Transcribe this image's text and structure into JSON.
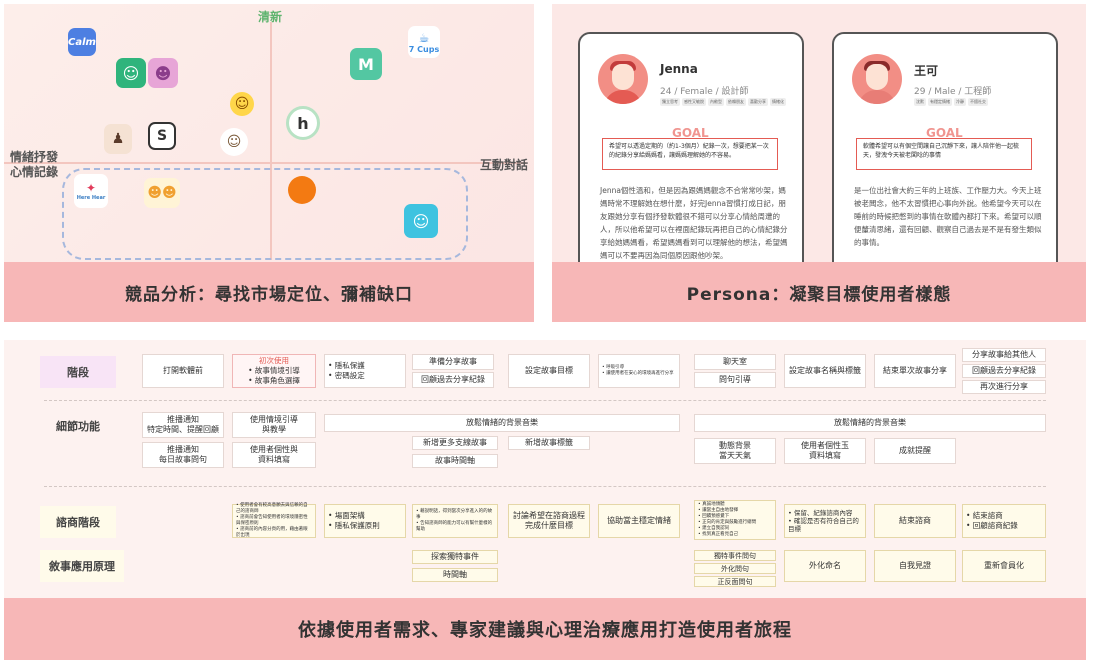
{
  "competitor": {
    "axis_top": "清新",
    "axis_left": "情緒抒發\n心情記錄",
    "axis_right": "互動對話",
    "banner": "競品分析：尋找市場定位、彌補缺口",
    "apps": [
      {
        "name": "calm",
        "label": "Calm"
      },
      {
        "name": "7cups",
        "label": "7 Cups"
      },
      {
        "name": "m-app",
        "label": "M"
      },
      {
        "name": "h-app",
        "label": "h"
      },
      {
        "name": "s-app",
        "label": "S"
      },
      {
        "name": "here-hear",
        "label": "Here Hear"
      }
    ]
  },
  "persona": {
    "banner": "Persona：凝聚目標使用者樣態",
    "goal_label": "GOAL",
    "cards": [
      {
        "name": "Jenna",
        "meta": "24 / Female / 設計師",
        "tags": [
          "獨立思考",
          "感性又敏銳",
          "內斂型",
          "依賴朋友",
          "喜歡分享",
          "情緒化"
        ],
        "goal": "希望可以透過定期的（約1-3個月）紀錄一次，想要把某一次的紀錄分享給媽媽看，讓媽媽理解她的不容易。",
        "desc": "Jenna個性溫和，但是因為跟媽媽觀念不合常常吵架，媽媽時常不理解她在想什麼，好完Jenna習慣打成日記，朋友跟她分享有個抒發軟體很不錯可以分享心情給周遭的人，所以他希望可以在裡面紀錄玩再把自己的心情紀錄分享給她媽媽看，希望媽媽看到可以理解他的想法，希望媽媽可以不要再因為同個原因跟他吵架。"
      },
      {
        "name": "王可",
        "meta": "29 / Male / 工程師",
        "tags": [
          "沈默",
          "有穩定情緒",
          "冷靜",
          "不擅社交"
        ],
        "goal": "軟體希望可以有個空間讓自己沉靜下來，讓人陪伴他一起梳天，發洩今天被老闆唸的事情",
        "desc": "是一位出社會大約三年的上班族、工作壓力大。今天上班被老闆念，他不太習慣把心事向外說。他希望今天可以在睡前的時候把憋到的事情在軟體內都打下來。希望可以順便釐清思緒，還有回顧、觀察自己過去是不是有發生類似的事情。"
      }
    ]
  },
  "journey": {
    "banner": "依據使用者需求、專家建議與心理治療應用打造使用者旅程",
    "row_labels": {
      "stage": "階段",
      "detail": "細節功能",
      "consult": "諮商階段",
      "narrative": "敘事應用原理"
    },
    "stages": {
      "open_app": "打開軟體前",
      "first_use_title": "初次使用",
      "first_use_items": "• 故事情境引導\n• 故事角色選擇",
      "privacy": "• 隱私保護\n• 密碼設定",
      "prepare_share": "準備分享故事",
      "review_share": "回顧過去分享紀錄",
      "set_goal": "設定故事目標",
      "guide": "• 呼吸引導\n• 讓使用者在安心的環境再進行分享",
      "chatroom": "聊天室",
      "questions": "問句引導",
      "name_story": "設定故事名稱與標籤",
      "end_share": "結束單次故事分享",
      "share_others": "分享故事給其他人",
      "review_record": "回顧過去分享紀錄",
      "share_again": "再次進行分享"
    },
    "details": {
      "notify1": "推播通知\n特定時間、提醒回顧",
      "notify2": "推播通知\n每日故事問句",
      "guide_teach": "使用情境引導\n與教學",
      "personal_info": "使用者個性與\n資料填寫",
      "bg_music1": "放鬆情緒的背景音樂",
      "more_stories": "新增更多支線故事",
      "story_tag": "新增故事標籤",
      "timeline": "故事時間軸",
      "bg_music2": "放鬆情緒的背景音樂",
      "dynamic_bg": "動態背景\n當天天氣",
      "personal_jade": "使用者個性玉\n資料填寫",
      "achievement": "成就提醒"
    },
    "consult": {
      "c1": "• 使用者會有較高意願去與信賴的自己的諮商師\n• 諮商前會告知使用者的環境隱密性與保密原則\n• 諮商前的內容分頁的用，藉由著眼於出現",
      "c2": "• 場面架構\n• 隱私保護原則",
      "c3": "• 藉說明話，得到當次分享進入的的故事\n• 告知諮商師的能力可以有幫什麼樣的幫助",
      "c4": "討論希望在諮商過程完成什麼目標",
      "c5": "協助當主穩定情緒",
      "c6": "• 真誠地傾聽\n• 讓當主自由地發揮\n• 回饋預感覺下\n• 正向的肯定與鼓勵進行總問\n• 建立自我認同\n• 找到真正看見自己",
      "c7": "• 保留、紀錄諮商內容\n• 確認是否有符合自己的目標",
      "c8": "結束諮商",
      "c9": "• 結束諮商\n• 回顧諮商紀錄"
    },
    "narrative": {
      "explore": "探索獨特事件",
      "timeline": "時間軸",
      "unique_q": "獨特事件問句",
      "externalize_q": "外化問句",
      "action_q": "正反面問句",
      "externalize_name": "外化命名",
      "self_see": "自我見證",
      "re_member": "重新會員化"
    }
  }
}
